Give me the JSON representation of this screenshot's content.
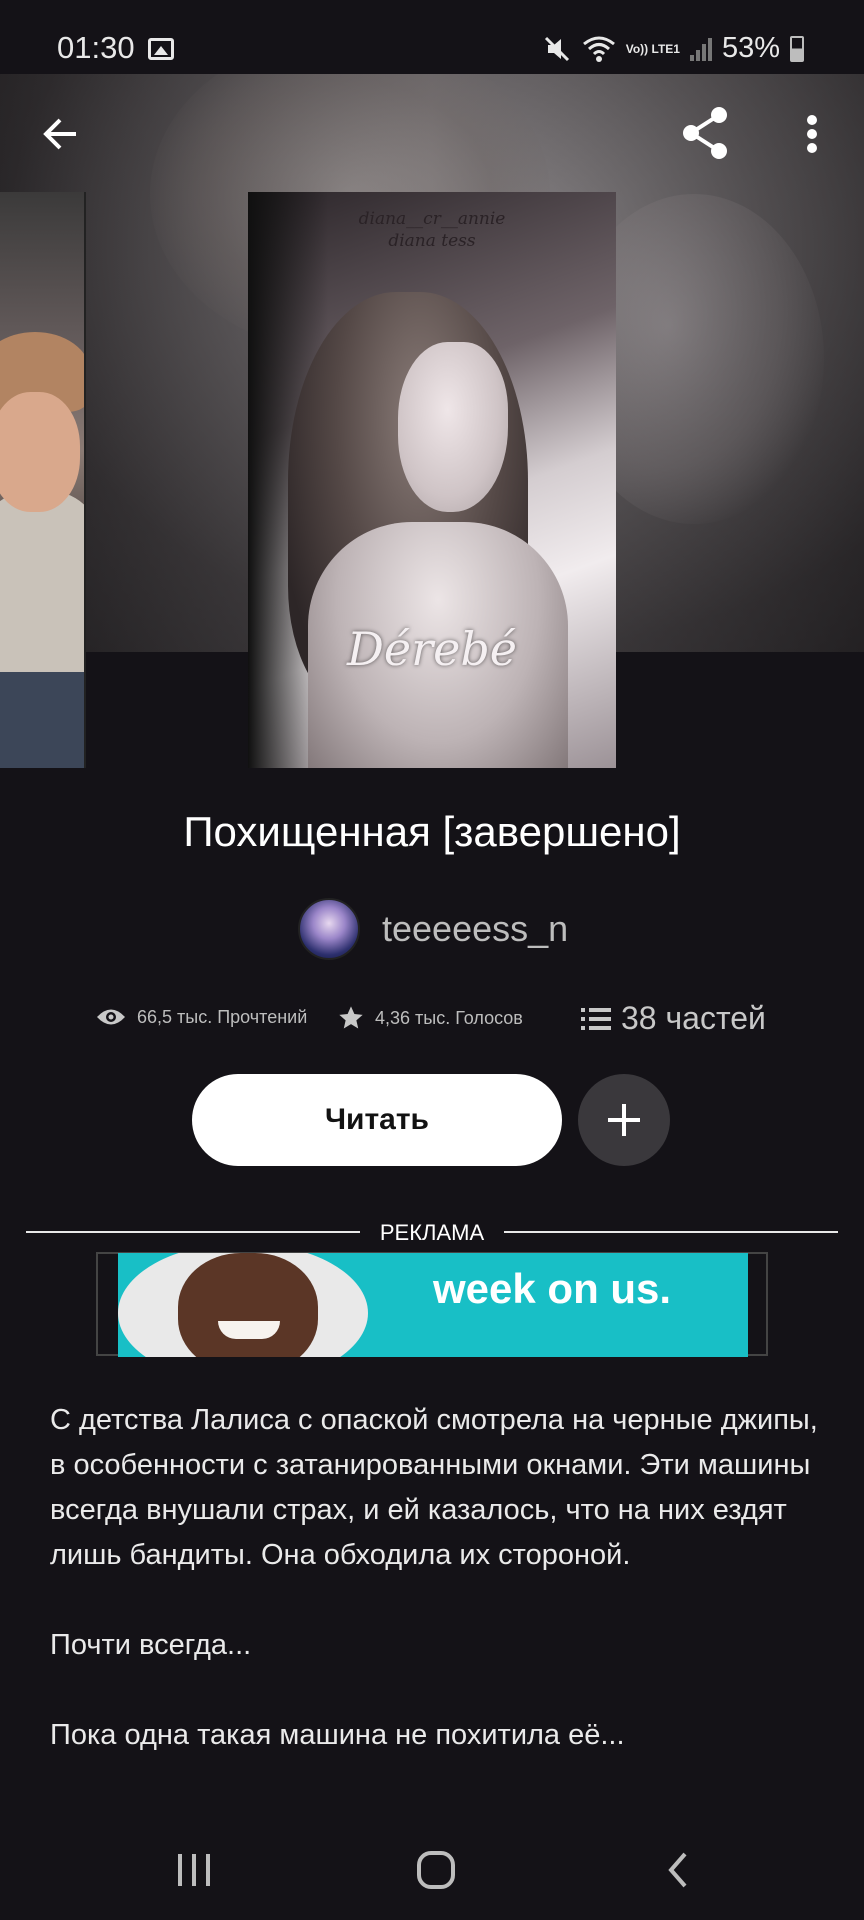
{
  "status_bar": {
    "time": "01:30",
    "battery": "53%",
    "network_label": "Vo)) LTE1",
    "icons": [
      "gallery-icon",
      "mute-icon",
      "wifi-icon",
      "signal-icon",
      "battery-icon"
    ]
  },
  "header": {
    "back_icon": "arrow-left-icon",
    "share_icon": "share-icon",
    "more_icon": "more-vertical-icon"
  },
  "cover": {
    "top_text_line1": "diana__cr__annie",
    "top_text_line2": "diana tess",
    "title_text": "Dérebé"
  },
  "story": {
    "title": "Похищенная [завершено]",
    "author": "teeeeess_n",
    "stats": {
      "reads": "66,5 тыс. Прочтений",
      "votes": "4,36 тыс. Голосов",
      "parts": "38 частей"
    },
    "read_button": "Читать",
    "add_button_icon": "plus-icon"
  },
  "ad": {
    "label": "РЕКЛАМА",
    "banner_text": "week on us."
  },
  "description": {
    "paragraphs": [
      "С детства Лалиса с опаской смотрела на черные джипы, в особенности с затанированными окнами. Эти машины всегда внушали страх, и ей казалось, что на них ездят лишь бандиты. Она обходила их стороной.",
      "Почти всегда...",
      "Пока одна такая машина не похитила её..."
    ]
  },
  "navbar": {
    "icons": [
      "recent-apps-icon",
      "home-icon",
      "back-icon"
    ]
  }
}
